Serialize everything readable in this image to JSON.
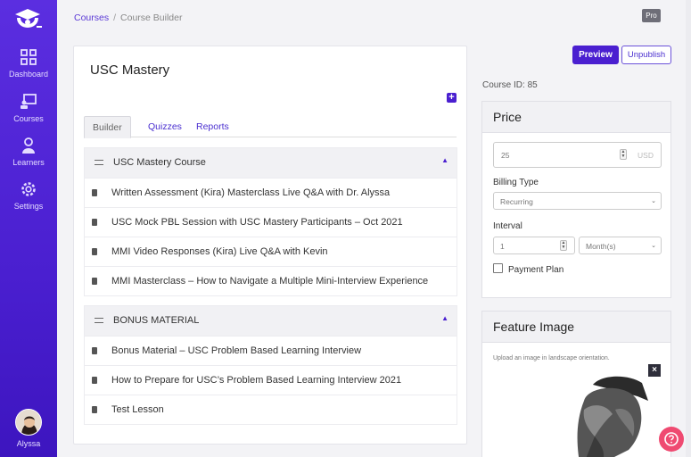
{
  "sidebar": {
    "items": [
      {
        "label": "Dashboard",
        "icon": "dashboard-icon"
      },
      {
        "label": "Courses",
        "icon": "courses-icon"
      },
      {
        "label": "Learners",
        "icon": "learners-icon"
      },
      {
        "label": "Settings",
        "icon": "gear-icon"
      }
    ],
    "user": {
      "name": "Alyssa"
    }
  },
  "breadcrumb": {
    "root": "Courses",
    "separator": "/",
    "current": "Course Builder"
  },
  "plan_badge": "Pro",
  "course": {
    "title": "USC Mastery",
    "tabs": [
      {
        "label": "Builder",
        "active": true
      },
      {
        "label": "Quizzes",
        "active": false
      },
      {
        "label": "Reports",
        "active": false
      }
    ],
    "sections": [
      {
        "title": "USC Mastery Course",
        "lessons": [
          "Written Assessment (Kira) Masterclass Live Q&A with Dr. Alyssa",
          "USC Mock PBL Session with USC Mastery Participants – Oct 2021",
          "MMI Video Responses (Kira) Live Q&A with Kevin",
          "MMI Masterclass – How to Navigate a Multiple Mini-Interview Experience"
        ]
      },
      {
        "title": "BONUS MATERIAL",
        "lessons": [
          "Bonus Material – USC Problem Based Learning Interview",
          "How to Prepare for USC’s Problem Based Learning Interview 2021",
          "Test Lesson"
        ]
      }
    ]
  },
  "actions": {
    "preview": "Preview",
    "unpublish": "Unpublish"
  },
  "course_id": "Course ID: 85",
  "price": {
    "heading": "Price",
    "amount": "25",
    "currency": "USD",
    "billing_label": "Billing Type",
    "billing_value": "Recurring",
    "interval_label": "Interval",
    "interval_value": "1",
    "period_value": "Month(s)",
    "payment_plan_label": "Payment Plan",
    "payment_plan_checked": false
  },
  "feature_image": {
    "heading": "Feature Image",
    "hint": "Upload an image in landscape orientation."
  },
  "colors": {
    "brand": "#4a1fd0",
    "help": "#ef4a71"
  }
}
